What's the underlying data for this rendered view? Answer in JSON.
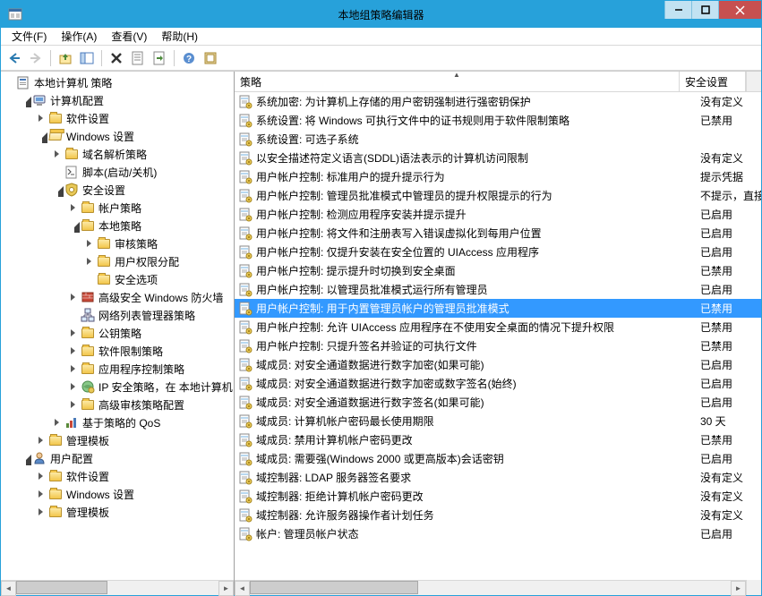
{
  "window": {
    "title": "本地组策略编辑器"
  },
  "menu": {
    "file": "文件(F)",
    "action": "操作(A)",
    "view": "查看(V)",
    "help": "帮助(H)"
  },
  "tree": {
    "root": "本地计算机 策略",
    "computer_config": "计算机配置",
    "software_settings": "软件设置",
    "windows_settings": "Windows 设置",
    "name_resolution": "域名解析策略",
    "scripts": "脚本(启动/关机)",
    "security_settings": "安全设置",
    "account_policies": "帐户策略",
    "local_policies": "本地策略",
    "audit_policy": "审核策略",
    "user_rights": "用户权限分配",
    "security_options": "安全选项",
    "windows_firewall": "高级安全 Windows 防火墙",
    "network_list": "网络列表管理器策略",
    "public_key": "公钥策略",
    "software_restriction": "软件限制策略",
    "app_control": "应用程序控制策略",
    "ip_security": "IP 安全策略，在 本地计算机",
    "advanced_audit": "高级审核策略配置",
    "policy_qos": "基于策略的 QoS",
    "admin_templates_c": "管理模板",
    "user_config": "用户配置",
    "software_settings_u": "软件设置",
    "windows_settings_u": "Windows 设置",
    "admin_templates_u": "管理模板"
  },
  "columns": {
    "policy": "策略",
    "security": "安全设置"
  },
  "policies": [
    {
      "name": "系统加密: 为计算机上存储的用户密钥强制进行强密钥保护",
      "value": "没有定义",
      "selected": false
    },
    {
      "name": "系统设置: 将 Windows 可执行文件中的证书规则用于软件限制策略",
      "value": "已禁用",
      "selected": false
    },
    {
      "name": "系统设置: 可选子系统",
      "value": "",
      "selected": false
    },
    {
      "name": "以安全描述符定义语言(SDDL)语法表示的计算机访问限制",
      "value": "没有定义",
      "selected": false
    },
    {
      "name": "用户帐户控制: 标准用户的提升提示行为",
      "value": "提示凭据",
      "selected": false
    },
    {
      "name": "用户帐户控制: 管理员批准模式中管理员的提升权限提示的行为",
      "value": "不提示，直接",
      "selected": false
    },
    {
      "name": "用户帐户控制: 检测应用程序安装并提示提升",
      "value": "已启用",
      "selected": false
    },
    {
      "name": "用户帐户控制: 将文件和注册表写入错误虚拟化到每用户位置",
      "value": "已启用",
      "selected": false
    },
    {
      "name": "用户帐户控制: 仅提升安装在安全位置的 UIAccess 应用程序",
      "value": "已启用",
      "selected": false
    },
    {
      "name": "用户帐户控制: 提示提升时切换到安全桌面",
      "value": "已禁用",
      "selected": false
    },
    {
      "name": "用户帐户控制: 以管理员批准模式运行所有管理员",
      "value": "已启用",
      "selected": false
    },
    {
      "name": "用户帐户控制: 用于内置管理员帐户的管理员批准模式",
      "value": "已禁用",
      "selected": true
    },
    {
      "name": "用户帐户控制: 允许 UIAccess 应用程序在不使用安全桌面的情况下提升权限",
      "value": "已禁用",
      "selected": false
    },
    {
      "name": "用户帐户控制: 只提升签名并验证的可执行文件",
      "value": "已禁用",
      "selected": false
    },
    {
      "name": "域成员: 对安全通道数据进行数字加密(如果可能)",
      "value": "已启用",
      "selected": false
    },
    {
      "name": "域成员: 对安全通道数据进行数字加密或数字签名(始终)",
      "value": "已启用",
      "selected": false
    },
    {
      "name": "域成员: 对安全通道数据进行数字签名(如果可能)",
      "value": "已启用",
      "selected": false
    },
    {
      "name": "域成员: 计算机帐户密码最长使用期限",
      "value": "30 天",
      "selected": false
    },
    {
      "name": "域成员: 禁用计算机帐户密码更改",
      "value": "已禁用",
      "selected": false
    },
    {
      "name": "域成员: 需要强(Windows 2000 或更高版本)会话密钥",
      "value": "已启用",
      "selected": false
    },
    {
      "name": "域控制器: LDAP 服务器签名要求",
      "value": "没有定义",
      "selected": false
    },
    {
      "name": "域控制器: 拒绝计算机帐户密码更改",
      "value": "没有定义",
      "selected": false
    },
    {
      "name": "域控制器: 允许服务器操作者计划任务",
      "value": "没有定义",
      "selected": false
    },
    {
      "name": "帐户: 管理员帐户状态",
      "value": "已启用",
      "selected": false
    }
  ]
}
